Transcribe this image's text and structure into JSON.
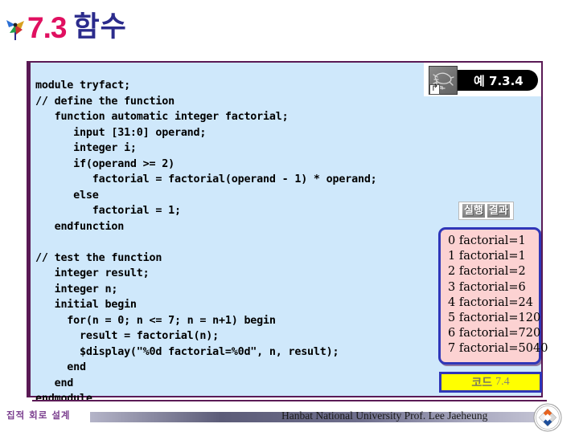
{
  "title": {
    "number": "7.3",
    "korean": "함수",
    "bullet_icon": "pinwheel-icon",
    "number_color": "#e01060",
    "korean_color": "#2b2b8c"
  },
  "example_badge": {
    "thumb_icon": "document-shortcut-icon",
    "label": "예 7.3.4",
    "pill_bg": "#000000",
    "pill_text_color": "#ffffff"
  },
  "code_panel": {
    "border_color": "#5a1a55",
    "background": "#cfe8fb",
    "lines": [
      "module tryfact;",
      "// define the function",
      "   function automatic integer factorial;",
      "      input [31:0] operand;",
      "      integer i;",
      "      if(operand >= 2)",
      "         factorial = factorial(operand - 1) * operand;",
      "      else",
      "         factorial = 1;",
      "   endfunction",
      "",
      "// test the function",
      "   integer result;",
      "   integer n;",
      "   initial begin",
      "     for(n = 0; n <= 7; n = n+1) begin",
      "       result = factorial(n);",
      "       $display(\"%0d factorial=%0d\", n, result);",
      "     end",
      "   end",
      "endmodule"
    ]
  },
  "run_result": {
    "label_part1": "실행",
    "label_part2": "결과",
    "box_border_color": "#2f36b8",
    "box_background": "#fcd2d2",
    "lines": [
      "0 factorial=1",
      "1 factorial=1",
      "2 factorial=2",
      "3 factorial=6",
      "4 factorial=24",
      "5 factorial=120",
      "6 factorial=720",
      "7 factorial=5040"
    ]
  },
  "code_caption": {
    "korean": "코드",
    "number": "7.4",
    "background": "#ffff00",
    "border_color": "#2f36b8"
  },
  "footer": {
    "left_label": "집적 회로 설계",
    "credit": "Hanbat National University Prof. Lee Jaeheung",
    "seal_icon": "university-seal-icon"
  }
}
